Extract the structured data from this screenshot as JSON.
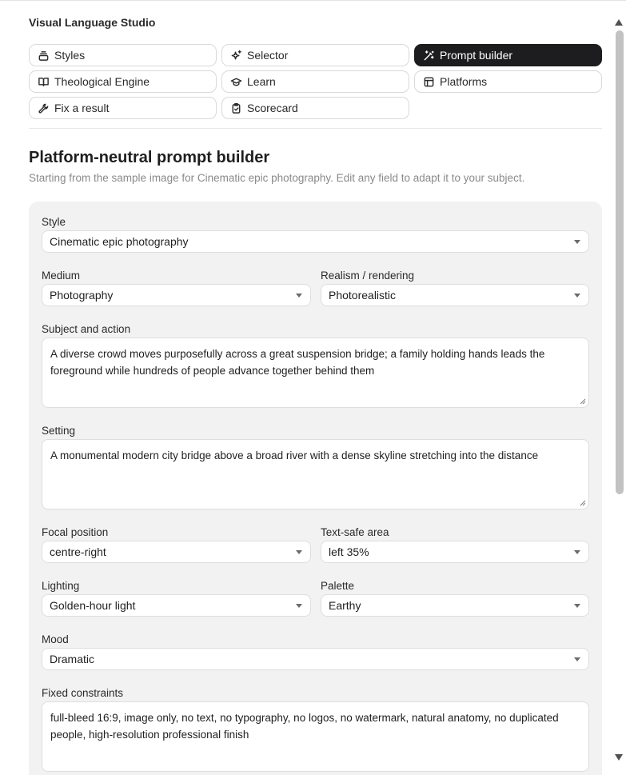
{
  "app": {
    "title": "Visual Language Studio"
  },
  "tabs": [
    {
      "label": "Styles",
      "icon": "stack-icon",
      "active": false
    },
    {
      "label": "Selector",
      "icon": "sparkles-icon",
      "active": false
    },
    {
      "label": "Prompt builder",
      "icon": "magic-wand-icon",
      "active": true
    },
    {
      "label": "Theological Engine",
      "icon": "book-icon",
      "active": false
    },
    {
      "label": "Learn",
      "icon": "graduation-cap-icon",
      "active": false
    },
    {
      "label": "Platforms",
      "icon": "layout-icon",
      "active": false
    },
    {
      "label": "Fix a result",
      "icon": "wrench-icon",
      "active": false
    },
    {
      "label": "Scorecard",
      "icon": "clipboard-check-icon",
      "active": false
    }
  ],
  "page": {
    "title": "Platform-neutral prompt builder",
    "subtitle": "Starting from the sample image for Cinematic epic photography. Edit any field to adapt it to your subject."
  },
  "form": {
    "style": {
      "label": "Style",
      "value": "Cinematic epic photography"
    },
    "medium": {
      "label": "Medium",
      "value": "Photography"
    },
    "realism": {
      "label": "Realism / rendering",
      "value": "Photorealistic"
    },
    "subject": {
      "label": "Subject and action",
      "value": "A diverse crowd moves purposefully across a great suspension bridge; a family holding hands leads the foreground while hundreds of people advance together behind them"
    },
    "setting": {
      "label": "Setting",
      "value": "A monumental modern city bridge above a broad river with a dense skyline stretching into the distance"
    },
    "focal": {
      "label": "Focal position",
      "value": "centre-right"
    },
    "textsafe": {
      "label": "Text-safe area",
      "value": "left 35%"
    },
    "lighting": {
      "label": "Lighting",
      "value": "Golden-hour light"
    },
    "palette": {
      "label": "Palette",
      "value": "Earthy"
    },
    "mood": {
      "label": "Mood",
      "value": "Dramatic"
    },
    "constraints": {
      "label": "Fixed constraints",
      "value": "full-bleed 16:9, image only, no text, no typography, no logos, no watermark, natural anatomy, no duplicated people, high-resolution professional finish"
    }
  },
  "colors": {
    "active_tab_bg": "#1d1d1f",
    "panel_bg": "#f2f2f2",
    "subtitle": "#8a8a8a"
  }
}
